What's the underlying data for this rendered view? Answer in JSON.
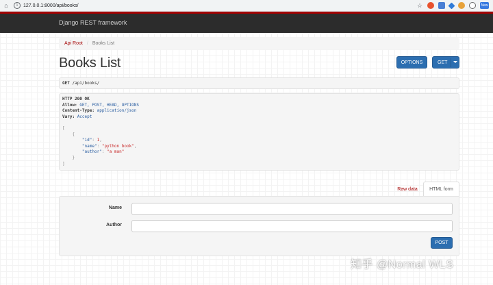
{
  "browser": {
    "url": "127.0.0.1:8000/api/books/",
    "info_icon": "info-icon",
    "home_icon": "home-icon",
    "star_icon": "star-icon",
    "extension_badge": "New"
  },
  "navbar": {
    "brand": "Django REST framework"
  },
  "breadcrumb": {
    "items": [
      "Api Root",
      "/",
      "Books List"
    ]
  },
  "page": {
    "title": "Books List",
    "options_label": "OPTIONS",
    "get_label": "GET"
  },
  "request": {
    "method": "GET",
    "path": "/api/books/"
  },
  "response": {
    "status": "HTTP 200 OK",
    "headers": [
      {
        "key": "Allow:",
        "value": "GET, POST, HEAD, OPTIONS"
      },
      {
        "key": "Content-Type:",
        "value": "application/json"
      },
      {
        "key": "Vary:",
        "value": "Accept"
      }
    ],
    "body": {
      "open_bracket": "[",
      "open_brace": "{",
      "id_key": "\"id\"",
      "id_value": "1",
      "name_key": "\"name\"",
      "name_value": "\"python book\"",
      "author_key": "\"author\"",
      "author_value": "\"a man\"",
      "close_brace": "}",
      "close_bracket": "]"
    }
  },
  "form": {
    "tabs": [
      "Raw data",
      "HTML form"
    ],
    "name_label": "Name",
    "author_label": "Author",
    "name_value": "",
    "author_value": "",
    "post_label": "POST"
  },
  "watermark": "知乎 @Normal WLS",
  "colors": {
    "accent": "#a30000",
    "primary_button": "#2c6eb0",
    "navbar": "#2c2c2c"
  }
}
